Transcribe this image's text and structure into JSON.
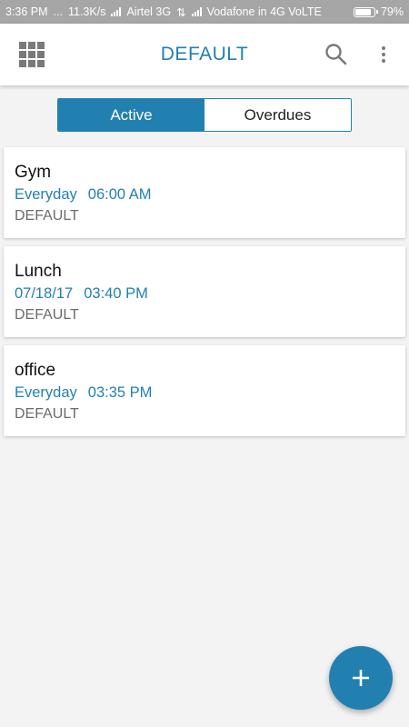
{
  "status_bar": {
    "time": "3:36 PM",
    "dots": "...",
    "speed": "11.3K/s",
    "carrier1": "Airtel 3G",
    "carrier2": "Vodafone in 4G VoLTE",
    "battery": "79%"
  },
  "app_bar": {
    "title": "DEFAULT",
    "icons": {
      "left": "grid-menu-icon",
      "search": "search-icon",
      "overflow": "more-vertical-icon"
    }
  },
  "tabs": [
    {
      "label": "Active",
      "selected": true
    },
    {
      "label": "Overdues",
      "selected": false
    }
  ],
  "tasks": [
    {
      "title": "Gym",
      "date": "Everyday",
      "time": "06:00 AM",
      "category": "DEFAULT"
    },
    {
      "title": "Lunch",
      "date": "07/18/17",
      "time": "03:40 PM",
      "category": "DEFAULT"
    },
    {
      "title": "office",
      "date": "Everyday",
      "time": "03:35 PM",
      "category": "DEFAULT"
    }
  ],
  "fab": {
    "icon": "plus-icon"
  },
  "colors": {
    "accent": "#2280b0",
    "status_bar": "#a6a6a6",
    "background": "#f3f3f3"
  }
}
